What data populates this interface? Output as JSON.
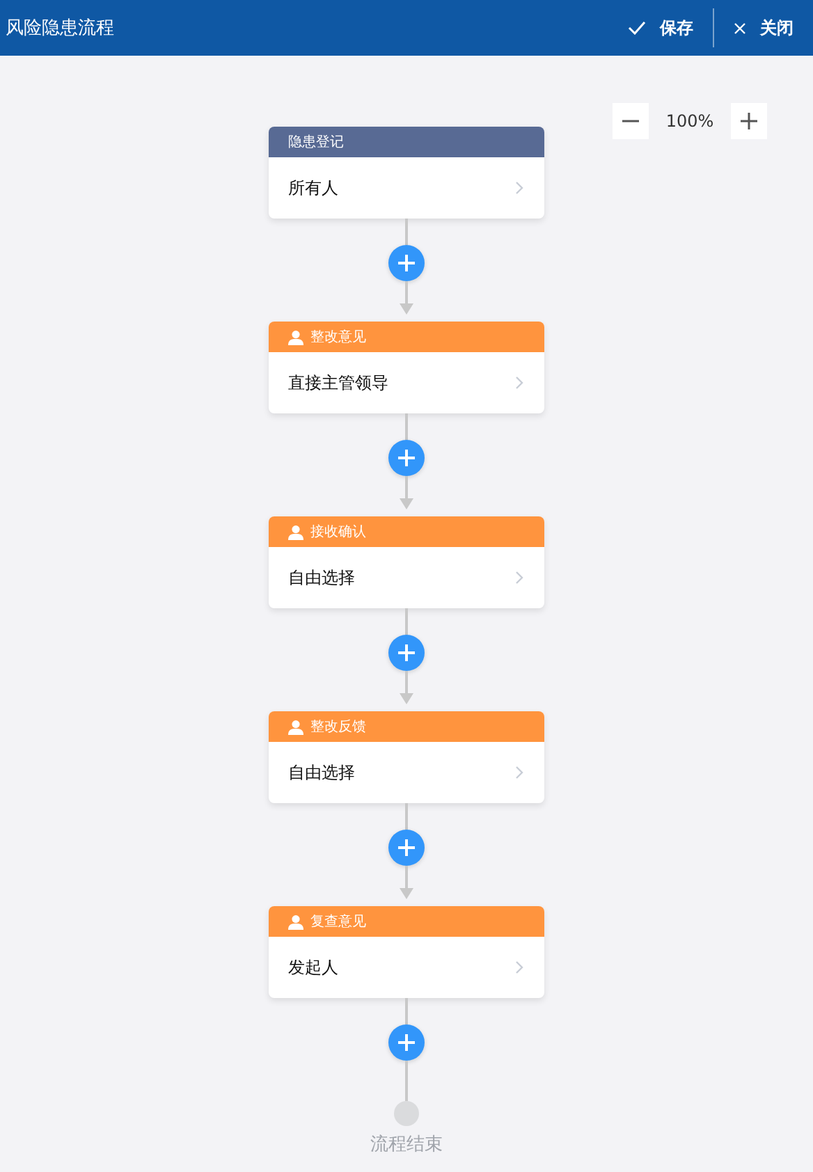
{
  "header": {
    "title": "风险隐患流程",
    "actions": [
      {
        "kind": "save",
        "label": "保存"
      },
      {
        "kind": "close",
        "label": "关闭"
      }
    ]
  },
  "zoom": {
    "value": "100%"
  },
  "nodes": [
    {
      "kind": "start",
      "title": "隐患登记",
      "assignee": "所有人"
    },
    {
      "kind": "approver",
      "title": "整改意见",
      "assignee": "直接主管领导"
    },
    {
      "kind": "approver",
      "title": "接收确认",
      "assignee": "自由选择"
    },
    {
      "kind": "approver",
      "title": "整改反馈",
      "assignee": "自由选择"
    },
    {
      "kind": "approver",
      "title": "复查意见",
      "assignee": "发起人"
    }
  ],
  "end": {
    "label": "流程结束"
  }
}
